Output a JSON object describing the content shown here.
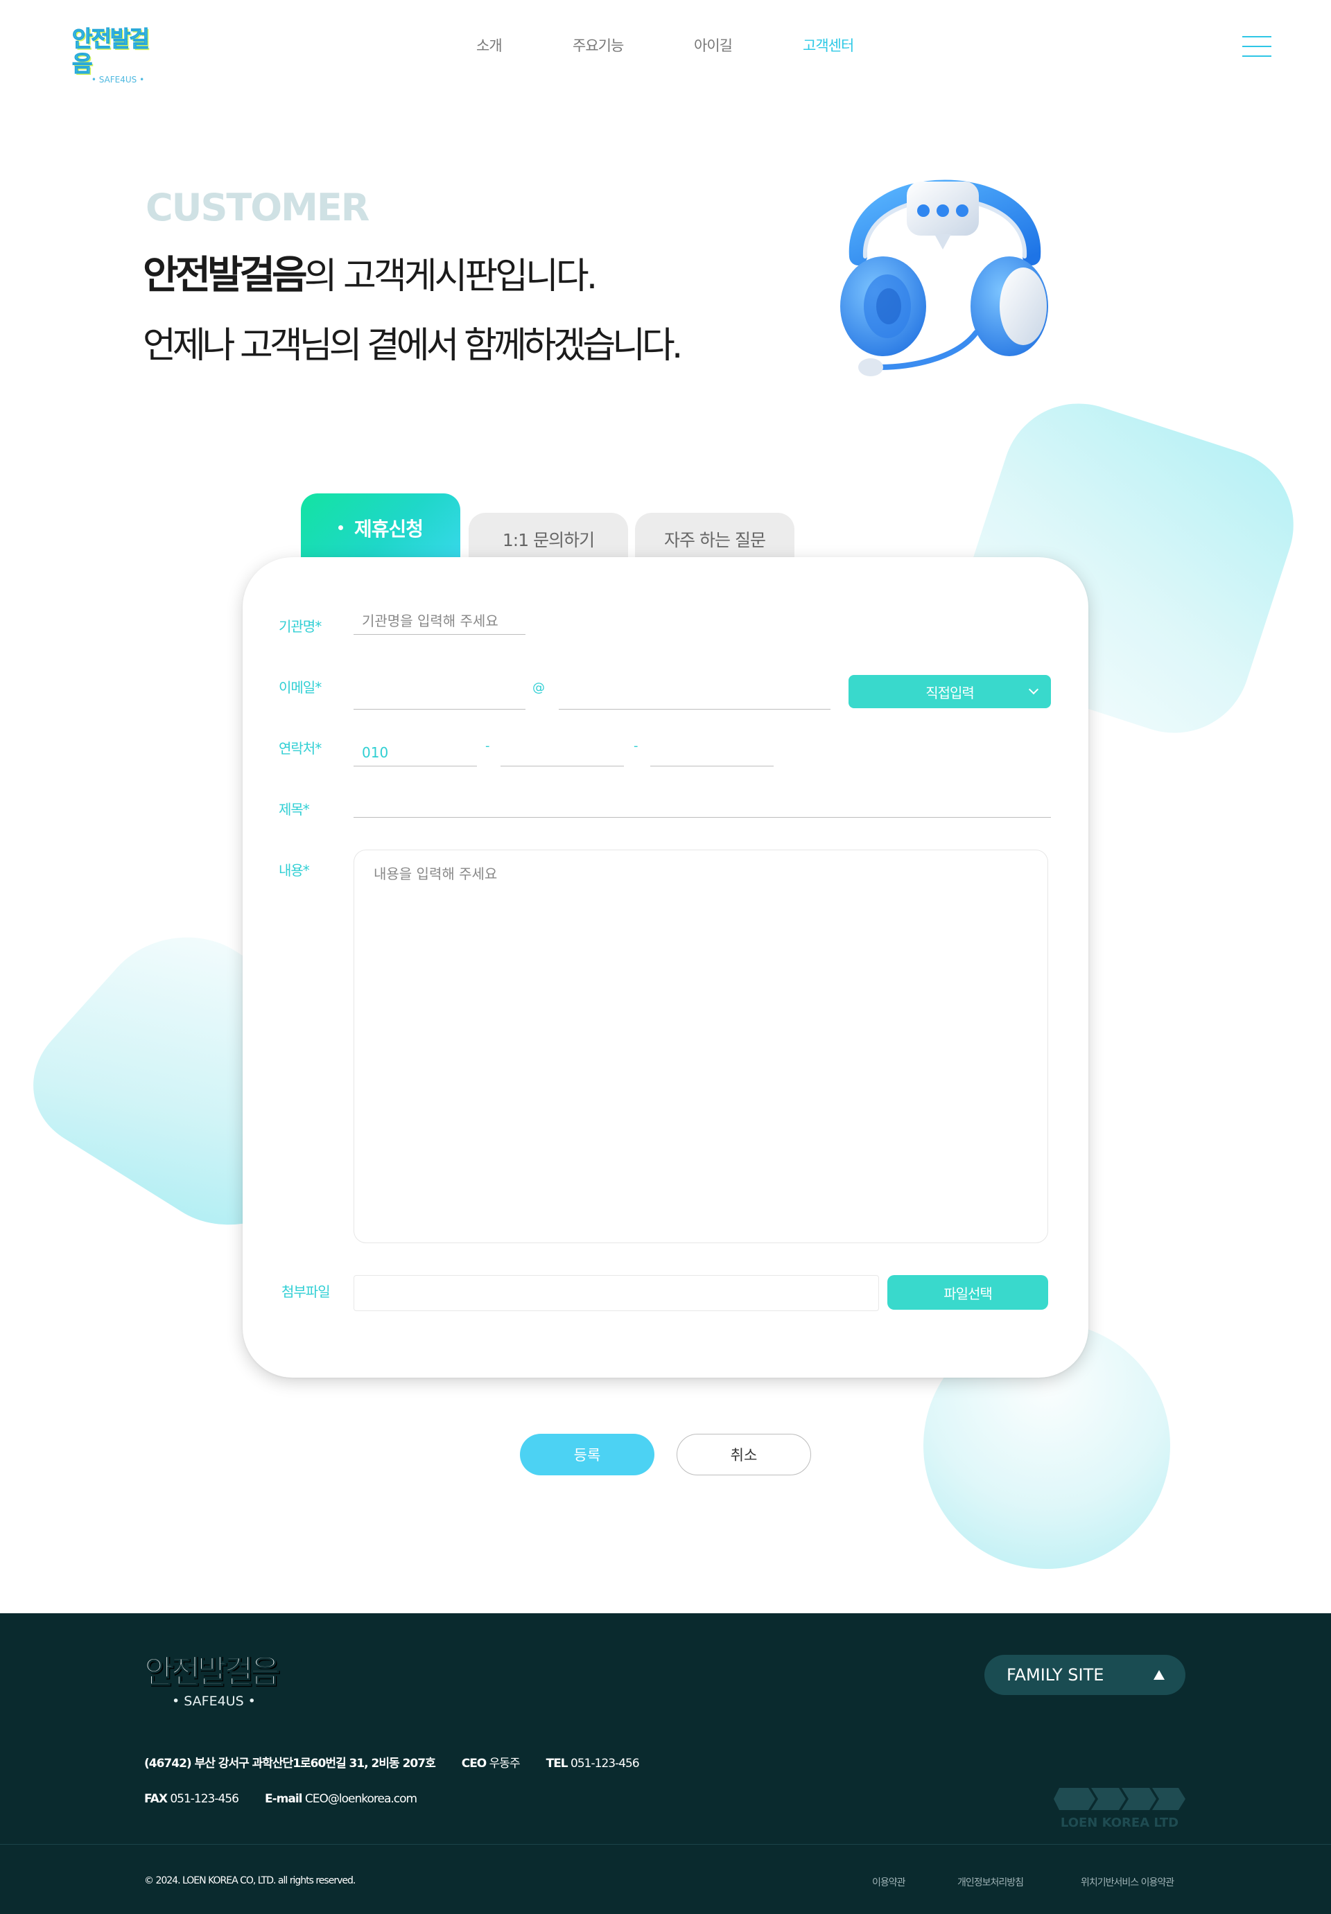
{
  "header": {
    "logo_main": "안전발걸음",
    "logo_sub": "• SAFE4US •",
    "nav": [
      "소개",
      "주요기능",
      "아이길",
      "고객센터"
    ],
    "active_nav": "고객센터"
  },
  "hero": {
    "eyebrow": "CUSTOMER",
    "title_bold": "안전발걸음",
    "title_rest": "의 고객게시판입니다.",
    "subtitle": "언제나 고객님의 곁에서 함께하겠습니다."
  },
  "tabs": [
    {
      "label": "제휴신청",
      "active": true
    },
    {
      "label": "1:1 문의하기",
      "active": false
    },
    {
      "label": "자주 하는 질문",
      "active": false
    }
  ],
  "form": {
    "org_label": "기관명*",
    "org_placeholder": "기관명을 입력해 주세요",
    "email_label": "이메일*",
    "email_at": "@",
    "email_select": "직접입력",
    "phone_label": "연락처*",
    "phone_prefix": "010",
    "phone_sep": "-",
    "subject_label": "제목*",
    "content_label": "내용*",
    "content_placeholder": "내용을 입력해 주세요",
    "file_label": "첨부파일",
    "file_button": "파일선택"
  },
  "actions": {
    "submit": "등록",
    "cancel": "취소"
  },
  "footer": {
    "logo_main": "안전발걸음",
    "logo_sub": "•  SAFE4US  •",
    "family_site": "FAMILY SITE",
    "address": "(46742) 부산 강서구 과학산단1로60번길 31, 2비동 207호",
    "ceo_label": "CEO",
    "ceo": "우동주",
    "tel_label": "TEL",
    "tel": "051-123-456",
    "fax_label": "FAX",
    "fax": "051-123-456",
    "email_label": "E-mail",
    "email": "CEO@loenkorea.com",
    "company_mark": "LOEN KOREA LTD",
    "copyright": "© 2024. LOEN KOREA CO, LTD. all rights reserved.",
    "links": [
      "이용약관",
      "개인정보처리방침",
      "위치기반서비스 이용약관"
    ]
  },
  "colors": {
    "accent": "#2ec9e6",
    "teal_button": "#39d9cc",
    "footer_bg": "#0a2a2e"
  },
  "icons": [
    "menu-icon",
    "headset-icon",
    "chevron-down-icon",
    "triangle-up-icon"
  ]
}
